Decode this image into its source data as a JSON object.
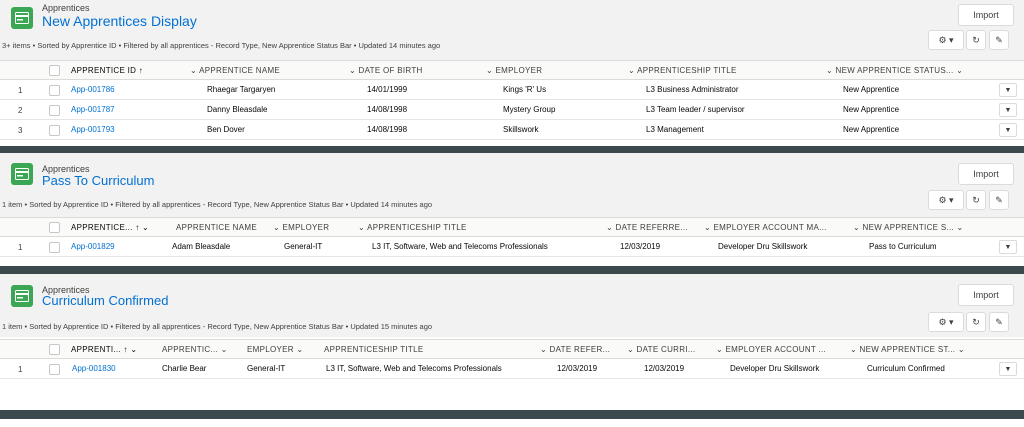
{
  "panels": [
    {
      "object_name": "Apprentices",
      "title": "New Apprentices Display",
      "info": "3+ items • Sorted by Apprentice ID • Filtered by all apprentices - Record Type, New Apprentice Status Bar • Updated 14 minutes ago",
      "import_label": "Import",
      "columns": [
        "APPRENTICE ID ↑",
        "APPRENTICE NAME",
        "DATE OF BIRTH",
        "EMPLOYER",
        "APPRENTICESHIP TITLE",
        "NEW APPRENTICE STATUS..."
      ],
      "rows": [
        {
          "num": "1",
          "cells": [
            "App-001786",
            "Rhaegar Targaryen",
            "14/01/1999",
            "Kings 'R' Us",
            "L3 Business Administrator",
            "New Apprentice"
          ]
        },
        {
          "num": "2",
          "cells": [
            "App-001787",
            "Danny Bleasdale",
            "14/08/1998",
            "Mystery Group",
            "L3 Team leader / supervisor",
            "New Apprentice"
          ]
        },
        {
          "num": "3",
          "cells": [
            "App-001793",
            "Ben Dover",
            "14/08/1998",
            "Skillswork",
            "L3 Management",
            "New Apprentice"
          ]
        }
      ]
    },
    {
      "object_name": "Apprentices",
      "title": "Pass To Curriculum",
      "info": "1 item • Sorted by Apprentice ID • Filtered by all apprentices - Record Type, New Apprentice Status Bar • Updated 14 minutes ago",
      "import_label": "Import",
      "columns": [
        "APPRENTICE... ↑",
        "APPRENTICE NAME",
        "EMPLOYER",
        "APPRENTICESHIP TITLE",
        "DATE REFERRE...",
        "EMPLOYER ACCOUNT MA...",
        "NEW APPRENTICE S..."
      ],
      "rows": [
        {
          "num": "1",
          "cells": [
            "App-001829",
            "Adam Bleasdale",
            "General-IT",
            "L3 IT, Software, Web and Telecoms Professionals",
            "12/03/2019",
            "Developer Dru Skillswork",
            "Pass to Curriculum"
          ]
        }
      ]
    },
    {
      "object_name": "Apprentices",
      "title": "Curriculum Confirmed",
      "info": "1 item • Sorted by Apprentice ID • Filtered by all apprentices - Record Type, New Apprentice Status Bar • Updated 15 minutes ago",
      "import_label": "Import",
      "columns": [
        "APPRENTI... ↑",
        "APPRENTIC...",
        "EMPLOYER",
        "APPRENTICESHIP TITLE",
        "DATE REFER...",
        "DATE CURRI...",
        "EMPLOYER ACCOUNT ...",
        "NEW APPRENTICE ST..."
      ],
      "rows": [
        {
          "num": "1",
          "cells": [
            "App-001830",
            "Charlie Bear",
            "General-IT",
            "L3 IT, Software, Web and Telecoms Professionals",
            "12/03/2019",
            "12/03/2019",
            "Developer Dru Skillswork",
            "Curriculum Confirmed"
          ]
        }
      ]
    }
  ]
}
